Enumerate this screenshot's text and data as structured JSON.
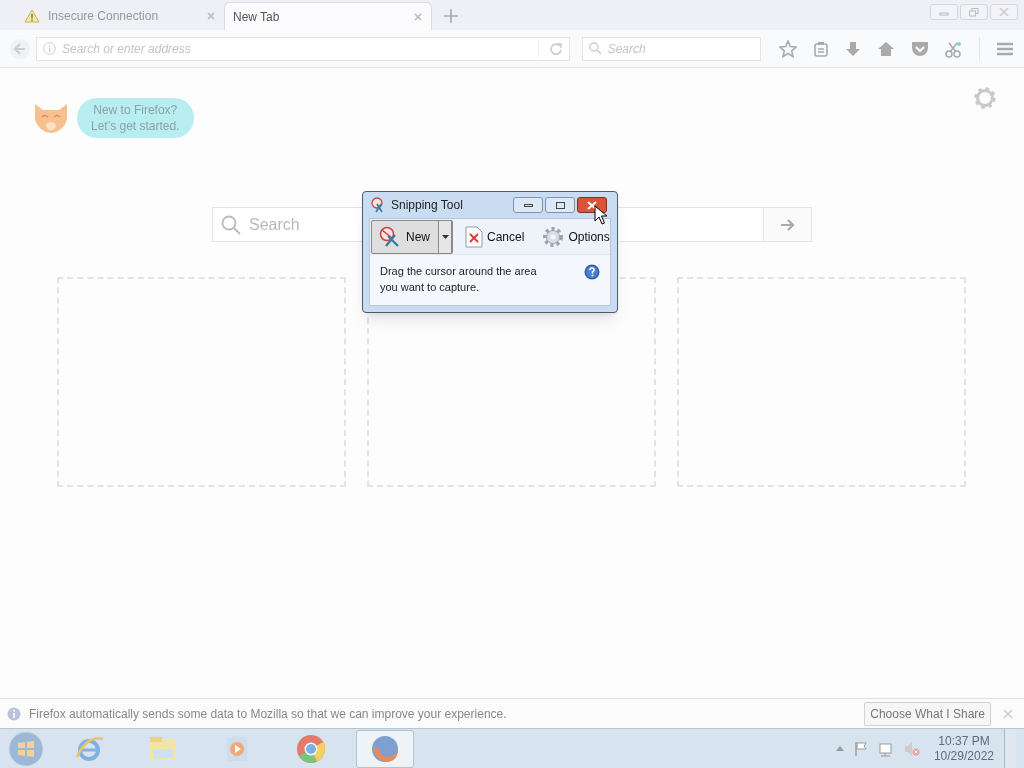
{
  "tabs": [
    {
      "label": "Insecure Connection",
      "kind": "insecure",
      "selected": false
    },
    {
      "label": "New Tab",
      "kind": "plain",
      "selected": true
    }
  ],
  "address_bar": {
    "placeholder": "Search or enter address"
  },
  "search_bar": {
    "placeholder": "Search"
  },
  "onboarding": {
    "bubble": "New to Firefox?\nLet’s get started."
  },
  "page_search": {
    "placeholder": "Search"
  },
  "tiles": [
    {
      "kind": "empty"
    },
    {
      "kind": "empty"
    },
    {
      "kind": "empty"
    }
  ],
  "snipping_tool": {
    "title": "Snipping Tool",
    "buttons": [
      {
        "label": "New",
        "kind": "new",
        "selected": true
      },
      {
        "label": "Cancel",
        "kind": "cancel",
        "selected": false
      },
      {
        "label": "Options",
        "kind": "options",
        "selected": false
      }
    ],
    "message": "Drag the cursor around the area\nyou want to capture."
  },
  "notification": {
    "text": "Firefox automatically sends some data to Mozilla so that we can improve your experience.",
    "button": "Choose What I Share"
  },
  "taskbar": {
    "apps": [
      {
        "kind": "ie",
        "selected": false
      },
      {
        "kind": "explorer",
        "selected": false
      },
      {
        "kind": "media",
        "selected": false
      },
      {
        "kind": "chrome",
        "selected": false
      },
      {
        "kind": "firefox",
        "selected": true
      }
    ],
    "time": "10:37 PM",
    "date": "10/29/2022"
  }
}
